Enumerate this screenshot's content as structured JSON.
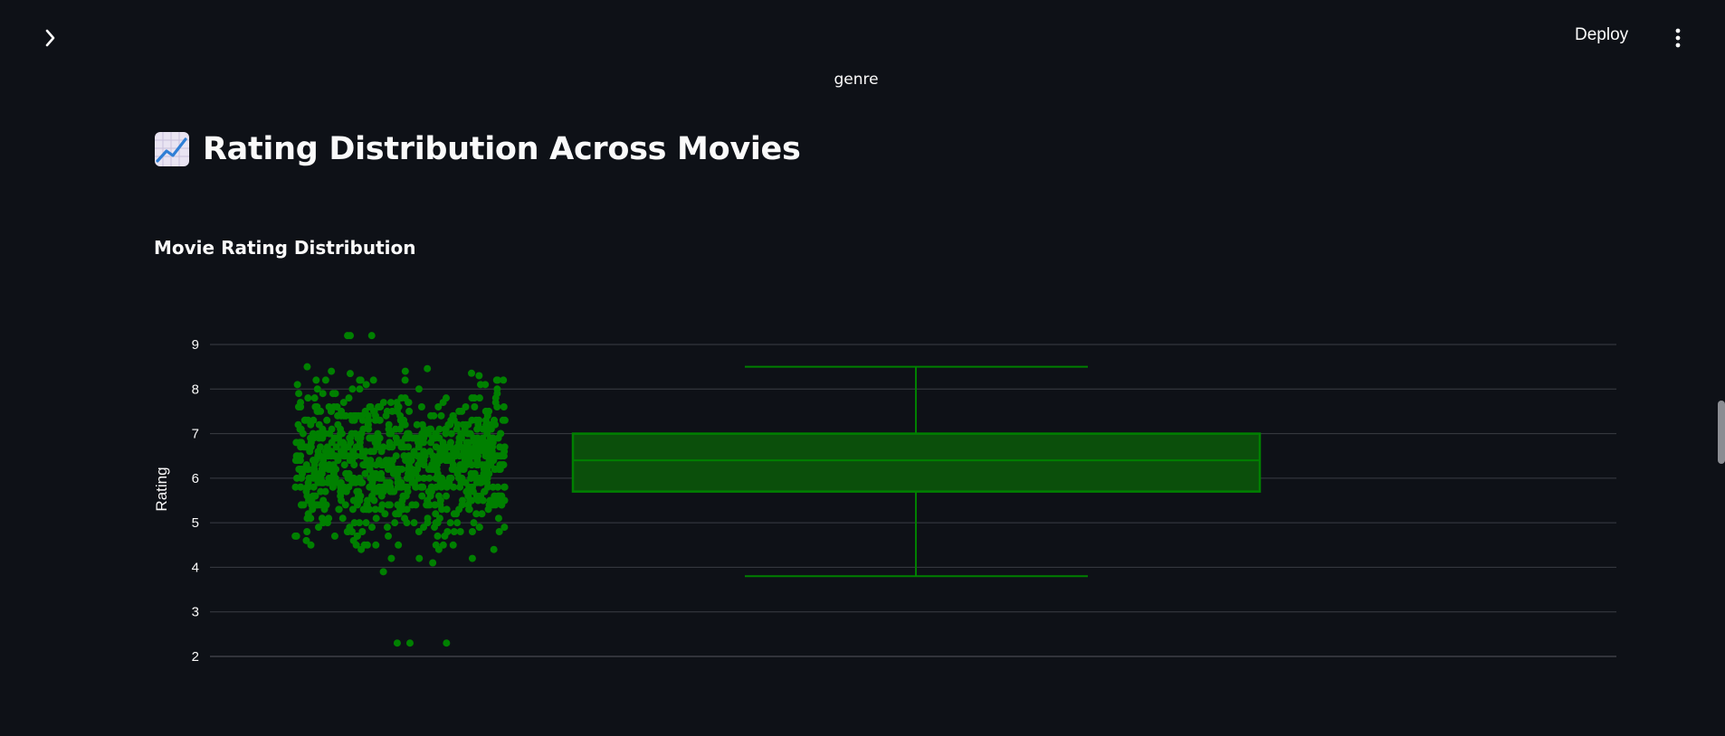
{
  "header": {
    "deploy_label": "Deploy",
    "sidebar_toggle_icon": "chevron-right-icon",
    "menu_icon": "vertical-dots-icon"
  },
  "caption": "genre",
  "title": {
    "icon": "chart-increasing-emoji",
    "text": "Rating Distribution Across Movies"
  },
  "subheader": "Movie Rating Distribution",
  "colors": {
    "background": "#0e1117",
    "accent": "#008000",
    "box_fill": "#0b4f0b",
    "grid": "#3a3d45",
    "text": "#fafafa"
  },
  "chart_data": {
    "type": "box",
    "title": "",
    "ylabel": "Rating",
    "xlabel": "",
    "ylim": [
      2,
      9
    ],
    "yticks": [
      "9",
      "8",
      "7",
      "6",
      "5",
      "4",
      "3",
      "2"
    ],
    "box": {
      "whisker_low": 3.8,
      "q1": 5.7,
      "median": 6.4,
      "q3": 7.0,
      "whisker_high": 8.5
    },
    "points_shown": true,
    "outliers": [
      9.2,
      9.2,
      9.2,
      2.3,
      2.3,
      2.3
    ],
    "grid": true
  }
}
